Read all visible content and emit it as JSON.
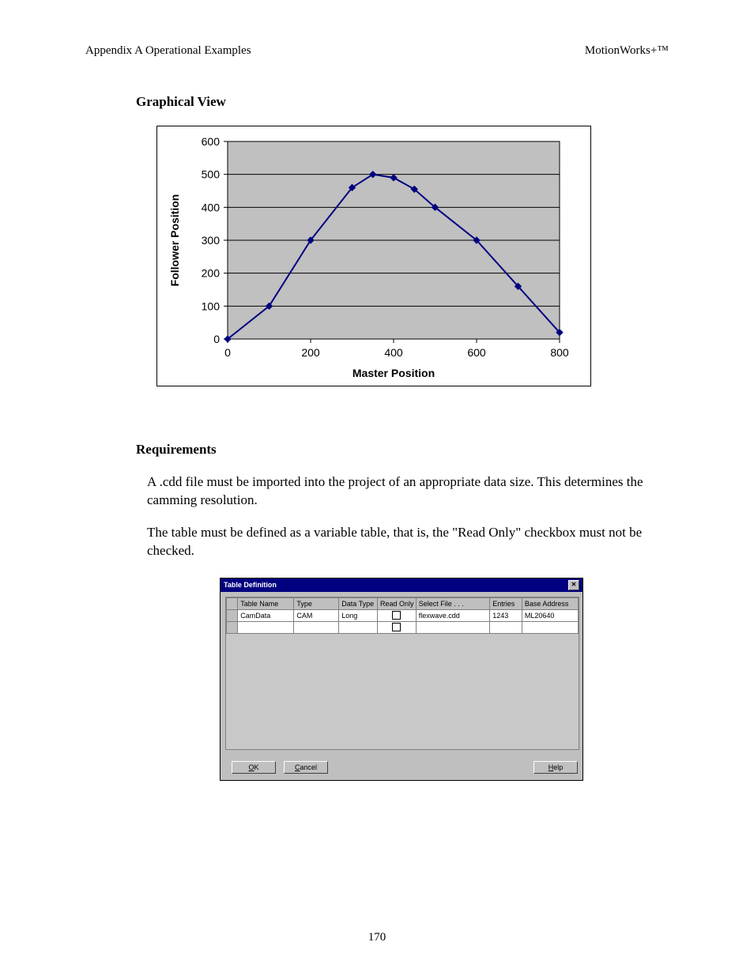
{
  "header": {
    "left": "Appendix A  Operational Examples",
    "right": "MotionWorks+™"
  },
  "sections": {
    "graphical_view_title": "Graphical View",
    "requirements_title": "Requirements",
    "para1": "A .cdd file must be imported into the project of an appropriate data size.  This determines the camming resolution.",
    "para2": "The table must be defined as a variable table, that is, the \"Read Only\" checkbox must not be checked."
  },
  "page_number": "170",
  "chart_data": {
    "type": "line",
    "xlabel": "Master Position",
    "ylabel": "Follower Position",
    "xlim": [
      0,
      800
    ],
    "ylim": [
      0,
      600
    ],
    "xticks": [
      0,
      200,
      400,
      600,
      800
    ],
    "yticks": [
      0,
      100,
      200,
      300,
      400,
      500,
      600
    ],
    "series": [
      {
        "name": "",
        "color": "#000080",
        "points": [
          {
            "x": 0,
            "y": 0
          },
          {
            "x": 100,
            "y": 100
          },
          {
            "x": 200,
            "y": 300
          },
          {
            "x": 300,
            "y": 460
          },
          {
            "x": 350,
            "y": 500
          },
          {
            "x": 400,
            "y": 490
          },
          {
            "x": 450,
            "y": 455
          },
          {
            "x": 500,
            "y": 400
          },
          {
            "x": 600,
            "y": 300
          },
          {
            "x": 700,
            "y": 160
          },
          {
            "x": 800,
            "y": 20
          }
        ]
      }
    ]
  },
  "dialog": {
    "title": "Table Definition",
    "columns": [
      "Table Name",
      "Type",
      "Data Type",
      "Read Only",
      "Select File . . .",
      "Entries",
      "Base Address"
    ],
    "rows": [
      {
        "table_name": "CamData",
        "type": "CAM",
        "data_type": "Long",
        "read_only": false,
        "select_file": "flexwave.cdd",
        "entries": "1243",
        "base_address": "ML20640"
      },
      {
        "table_name": "",
        "type": "",
        "data_type": "",
        "read_only": false,
        "select_file": "",
        "entries": "",
        "base_address": ""
      }
    ],
    "buttons": {
      "ok": "OK",
      "cancel": "Cancel",
      "help": "Help"
    }
  }
}
